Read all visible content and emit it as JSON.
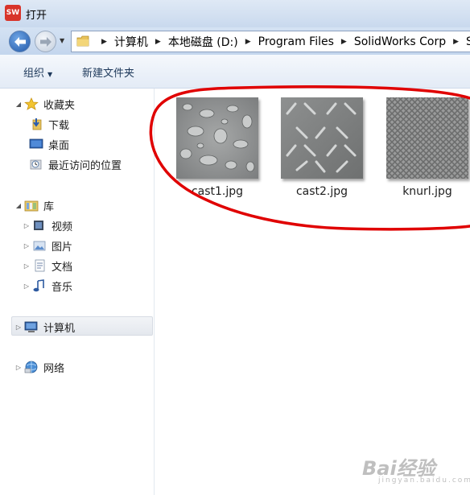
{
  "window": {
    "title": "打开",
    "app_logo": "SW"
  },
  "address": {
    "breadcrumbs": [
      "计算机",
      "本地磁盘 (D:)",
      "Program Files",
      "SolidWorks Corp",
      "So"
    ]
  },
  "toolbar": {
    "organize_label": "组织",
    "new_folder_label": "新建文件夹"
  },
  "sidebar": {
    "favorites": {
      "label": "收藏夹",
      "items": [
        {
          "label": "下载",
          "icon": "download-folder-icon"
        },
        {
          "label": "桌面",
          "icon": "desktop-icon"
        },
        {
          "label": "最近访问的位置",
          "icon": "recent-places-icon"
        }
      ]
    },
    "libraries": {
      "label": "库",
      "items": [
        {
          "label": "视频",
          "icon": "videos-library-icon"
        },
        {
          "label": "图片",
          "icon": "pictures-library-icon"
        },
        {
          "label": "文档",
          "icon": "documents-library-icon"
        },
        {
          "label": "音乐",
          "icon": "music-library-icon"
        }
      ]
    },
    "computer": {
      "label": "计算机",
      "icon": "computer-icon",
      "selected": true
    },
    "network": {
      "label": "网络",
      "icon": "network-icon"
    }
  },
  "files": [
    {
      "name": "cast1.jpg",
      "texture": "cast-droplets"
    },
    {
      "name": "cast2.jpg",
      "texture": "diamond-plate"
    },
    {
      "name": "knurl.jpg",
      "texture": "knurl-grid"
    }
  ],
  "annotation": {
    "color": "#e00000",
    "shape": "hand-drawn ellipse around file thumbnails"
  },
  "watermark": {
    "text": "Bai经验",
    "sub": "jingyan.baidu.com"
  },
  "colors": {
    "titlebar": "#c9d9ee",
    "toolbar_text": "#1e395b",
    "nav_back": "#2158a8"
  }
}
